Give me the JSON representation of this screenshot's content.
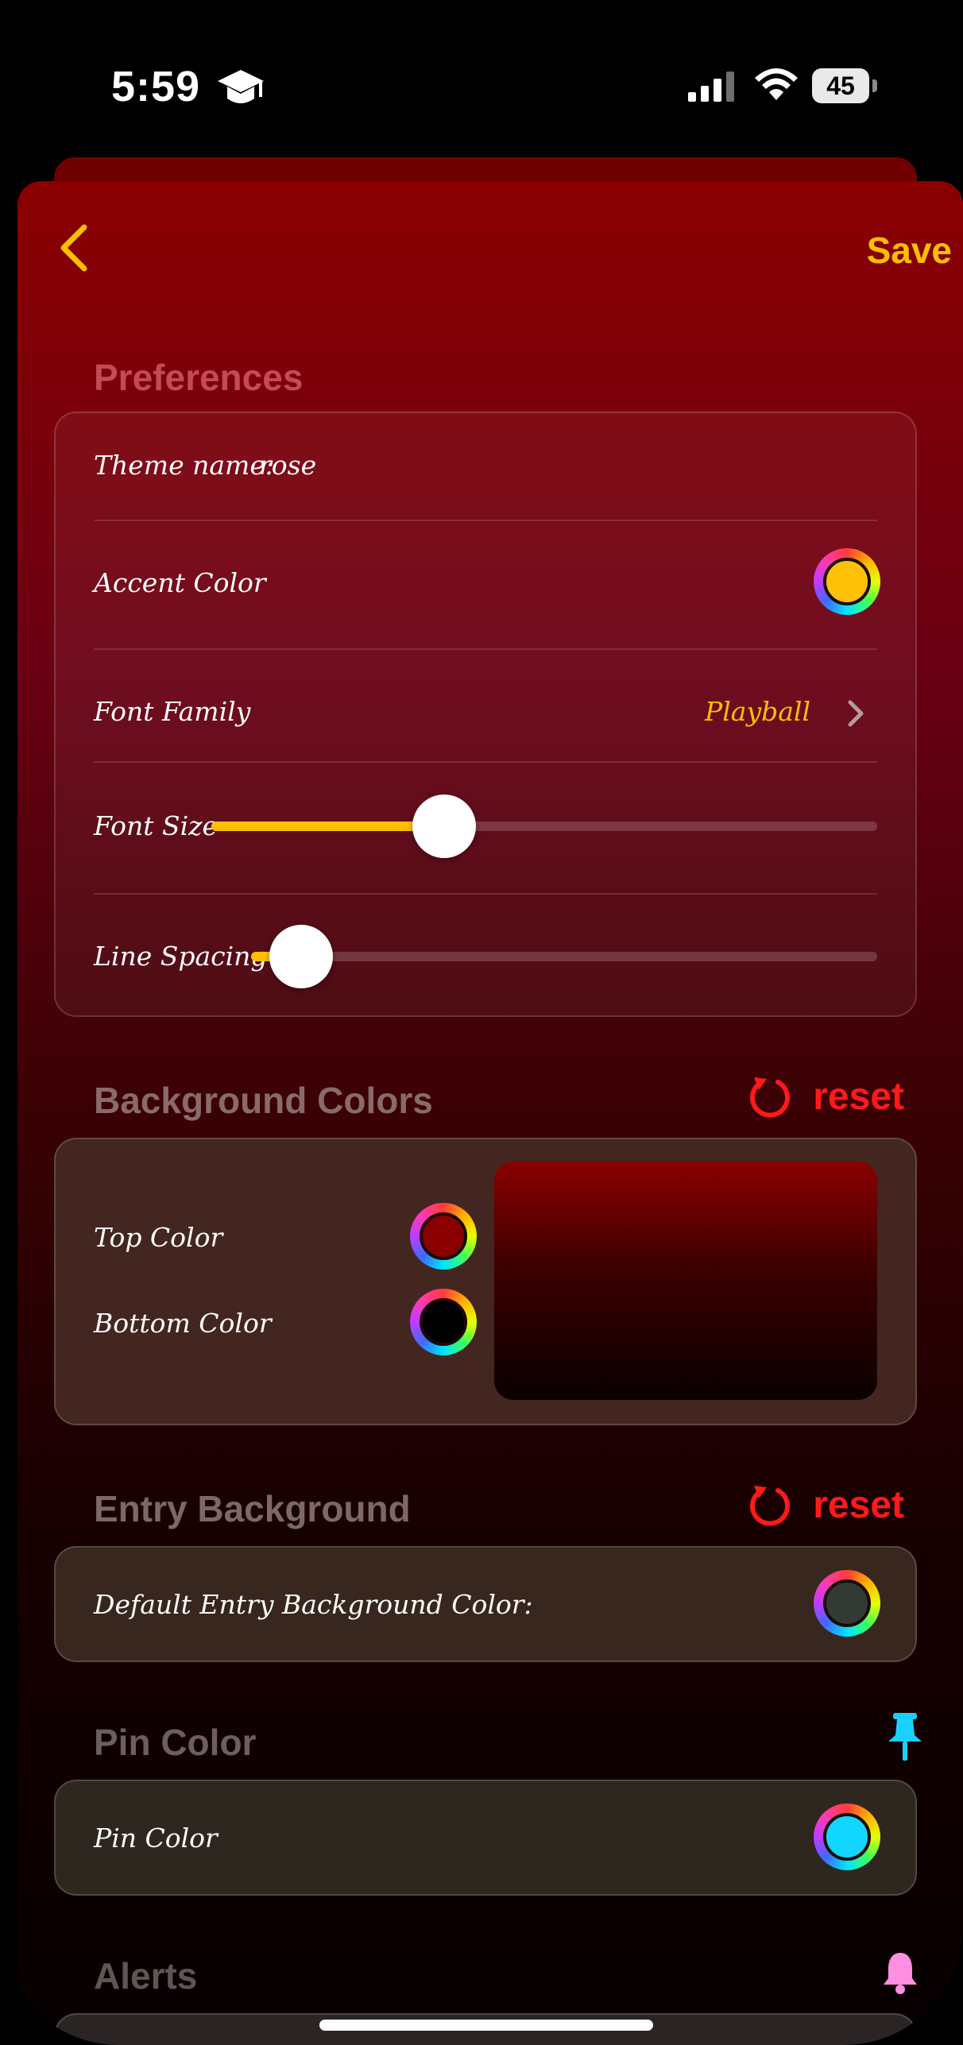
{
  "status_bar": {
    "time": "5:59",
    "battery": "45"
  },
  "nav": {
    "save_label": "Save"
  },
  "preferences": {
    "title": "Preferences",
    "theme_name_label": "Theme name:",
    "theme_name_value": "rose",
    "accent_color_label": "Accent Color",
    "accent_color": "#ffc107",
    "font_family_label": "Font Family",
    "font_family_value": "Playball",
    "font_size_label": "Font Size",
    "font_size_level": 0.35,
    "line_spacing_label": "Line Spacing",
    "line_spacing_level": 0.08
  },
  "background_colors": {
    "title": "Background Colors",
    "reset_label": "reset",
    "top_color_label": "Top Color",
    "top_color": "#8a0000",
    "bottom_color_label": "Bottom Color",
    "bottom_color": "#000000"
  },
  "entry_background": {
    "title": "Entry Background",
    "reset_label": "reset",
    "default_label": "Default Entry Background Color:",
    "color": "#333a34"
  },
  "pin_color": {
    "title": "Pin Color",
    "label": "Pin Color",
    "color": "#12d6ff"
  },
  "alerts": {
    "title": "Alerts"
  },
  "colors": {
    "accent": "#ffbf00",
    "reset": "#ff1a1a",
    "pin_icon": "#1ad0ff",
    "bell_icon": "#ff8fe0"
  },
  "icons": [
    "graduation-cap-icon",
    "cellular-signal-icon",
    "wifi-icon",
    "battery-icon",
    "back-chevron-icon",
    "chevron-right-icon",
    "reset-icon",
    "pin-icon",
    "bell-icon"
  ]
}
